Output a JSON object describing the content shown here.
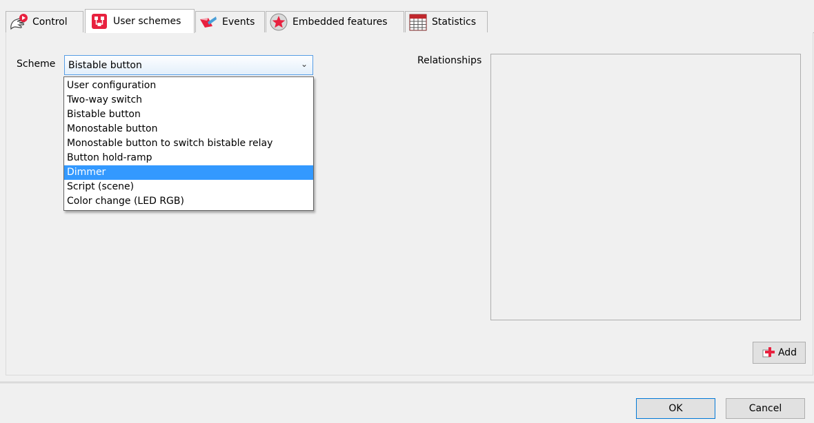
{
  "tabs": [
    {
      "label": "Control",
      "icon": "hand-pointer-icon"
    },
    {
      "label": "User schemes",
      "icon": "user-schemes-icon"
    },
    {
      "label": "Events",
      "icon": "events-icon"
    },
    {
      "label": "Embedded features",
      "icon": "star-icon"
    },
    {
      "label": "Statistics",
      "icon": "calendar-grid-icon"
    }
  ],
  "active_tab": "User schemes",
  "scheme": {
    "label": "Scheme",
    "selected": "Bistable button",
    "options": [
      "User configuration",
      "Two-way switch",
      "Bistable button",
      "Monostable button",
      "Monostable button to switch bistable relay",
      "Button hold-ramp",
      "Dimmer",
      "Script (scene)",
      "Color change (LED RGB)"
    ],
    "highlighted": "Dimmer"
  },
  "relationships": {
    "label": "Relationships"
  },
  "buttons": {
    "add": "Add",
    "ok": "OK",
    "cancel": "Cancel"
  },
  "colors": {
    "accent": "#3399ff",
    "icon_red": "#e8213f",
    "focus_border": "#569de5"
  }
}
